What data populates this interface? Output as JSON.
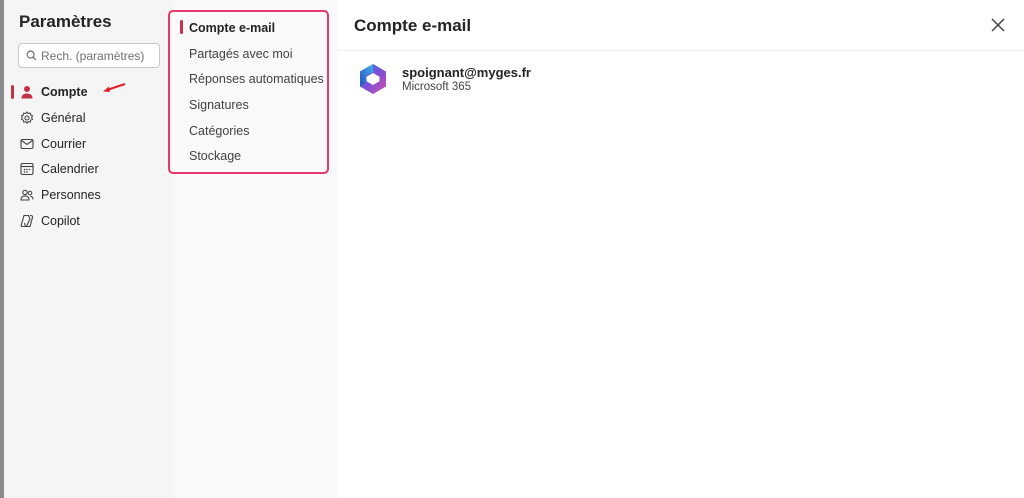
{
  "nav": {
    "title": "Paramètres",
    "search_placeholder": "Rech. (paramètres)",
    "items": [
      {
        "label": "Compte",
        "icon": "person-icon",
        "active": true
      },
      {
        "label": "Général",
        "icon": "gear-icon"
      },
      {
        "label": "Courrier",
        "icon": "mail-icon"
      },
      {
        "label": "Calendrier",
        "icon": "calendar-icon"
      },
      {
        "label": "Personnes",
        "icon": "people-icon"
      },
      {
        "label": "Copilot",
        "icon": "copilot-icon"
      }
    ]
  },
  "subnav": {
    "items": [
      {
        "label": "Compte e-mail",
        "active": true
      },
      {
        "label": "Partagés avec moi"
      },
      {
        "label": "Réponses automatiques"
      },
      {
        "label": "Signatures"
      },
      {
        "label": "Catégories"
      },
      {
        "label": "Stockage"
      }
    ]
  },
  "content": {
    "title": "Compte e-mail",
    "account": {
      "email": "spoignant@myges.fr",
      "product": "Microsoft 365"
    }
  },
  "colors": {
    "accent": "#c4314b",
    "highlight_box": "#e23a6b",
    "annotation_arrow": "#e0202a"
  }
}
